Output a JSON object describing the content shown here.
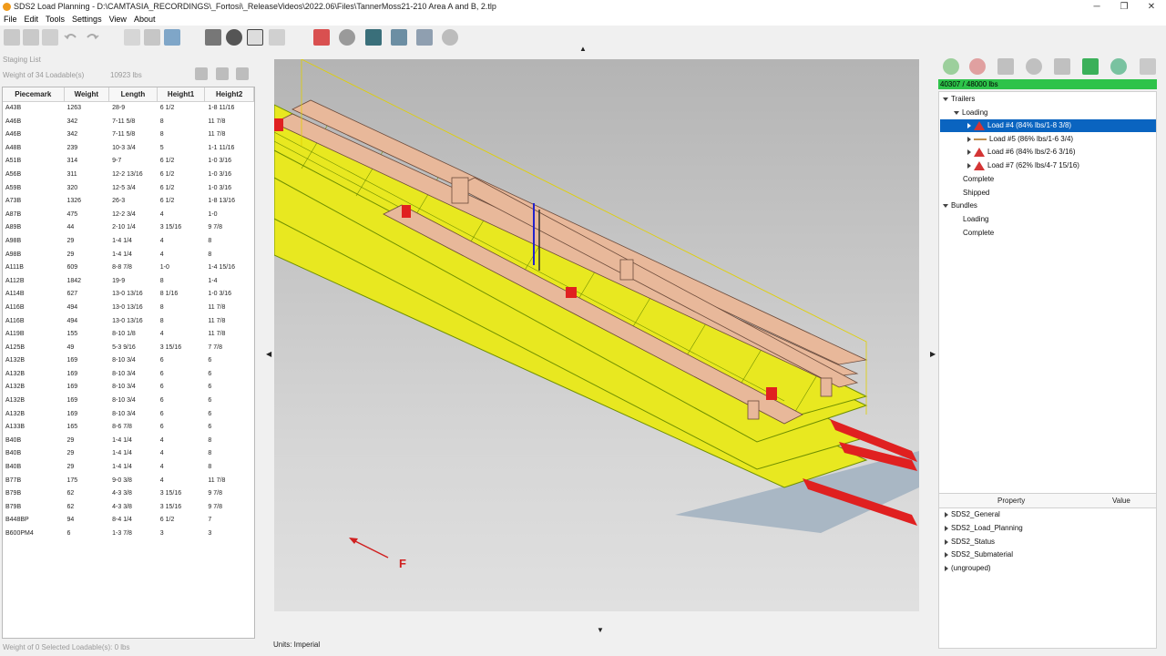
{
  "window": {
    "title": "SDS2 Load Planning - D:\\CAMTASIA_RECORDINGS\\_Fortosi\\_ReleaseVideos\\2022.06\\Files\\TannerMoss21-210 Area A and B, 2.tlp",
    "minimize": "─",
    "maximize": "❐",
    "close": "✕"
  },
  "menu": [
    "File",
    "Edit",
    "Tools",
    "Settings",
    "View",
    "About"
  ],
  "staging": {
    "title": "Staging List",
    "weight_label": "Weight of 34 Loadable(s)",
    "weight_value": "10923 lbs",
    "columns": [
      "Piecemark",
      "Weight",
      "Length",
      "Height1",
      "Height2"
    ],
    "rows": [
      [
        "A43B",
        "1263",
        "28-9",
        "6 1/2",
        "1-8 11/16"
      ],
      [
        "A46B",
        "342",
        "7-11 5/8",
        "8",
        "11 7/8"
      ],
      [
        "A46B",
        "342",
        "7-11 5/8",
        "8",
        "11 7/8"
      ],
      [
        "A48B",
        "239",
        "10-3 3/4",
        "5",
        "1-1 11/16"
      ],
      [
        "A51B",
        "314",
        "9-7",
        "6 1/2",
        "1-0 3/16"
      ],
      [
        "A56B",
        "311",
        "12-2 13/16",
        "6 1/2",
        "1-0 3/16"
      ],
      [
        "A59B",
        "320",
        "12-5 3/4",
        "6 1/2",
        "1-0 3/16"
      ],
      [
        "A73B",
        "1326",
        "26-3",
        "6 1/2",
        "1-8 13/16"
      ],
      [
        "A87B",
        "475",
        "12-2 3/4",
        "4",
        "1-0"
      ],
      [
        "A89B",
        "44",
        "2-10 1/4",
        "3 15/16",
        "9 7/8"
      ],
      [
        "A98B",
        "29",
        "1-4 1/4",
        "4",
        "8"
      ],
      [
        "A98B",
        "29",
        "1-4 1/4",
        "4",
        "8"
      ],
      [
        "A111B",
        "609",
        "8-8 7/8",
        "1-0",
        "1-4 15/16"
      ],
      [
        "A112B",
        "1842",
        "19-9",
        "8",
        "1-4"
      ],
      [
        "A114B",
        "627",
        "13-0 13/16",
        "8 1/16",
        "1-0 3/16"
      ],
      [
        "A116B",
        "494",
        "13-0 13/16",
        "8",
        "11 7/8"
      ],
      [
        "A116B",
        "494",
        "13-0 13/16",
        "8",
        "11 7/8"
      ],
      [
        "A119B",
        "155",
        "8-10 1/8",
        "4",
        "11 7/8"
      ],
      [
        "A125B",
        "49",
        "5-3 9/16",
        "3 15/16",
        "7 7/8"
      ],
      [
        "A132B",
        "169",
        "8-10 3/4",
        "6",
        "6"
      ],
      [
        "A132B",
        "169",
        "8-10 3/4",
        "6",
        "6"
      ],
      [
        "A132B",
        "169",
        "8-10 3/4",
        "6",
        "6"
      ],
      [
        "A132B",
        "169",
        "8-10 3/4",
        "6",
        "6"
      ],
      [
        "A132B",
        "169",
        "8-10 3/4",
        "6",
        "6"
      ],
      [
        "A133B",
        "165",
        "8-6 7/8",
        "6",
        "6"
      ],
      [
        "B40B",
        "29",
        "1-4 1/4",
        "4",
        "8"
      ],
      [
        "B40B",
        "29",
        "1-4 1/4",
        "4",
        "8"
      ],
      [
        "B40B",
        "29",
        "1-4 1/4",
        "4",
        "8"
      ],
      [
        "B77B",
        "175",
        "9-0 3/8",
        "4",
        "11 7/8"
      ],
      [
        "B79B",
        "62",
        "4-3 3/8",
        "3 15/16",
        "9 7/8"
      ],
      [
        "B79B",
        "62",
        "4-3 3/8",
        "3 15/16",
        "9 7/8"
      ],
      [
        "B448BP",
        "94",
        "8-4 1/4",
        "6 1/2",
        "7"
      ],
      [
        "B600PM4",
        "6",
        "1-3 7/8",
        "3",
        "3"
      ]
    ],
    "selected_status": "Weight of 0 Selected Loadable(s): 0 lbs"
  },
  "viewport": {
    "units": "Units: Imperial",
    "axis_label": "F",
    "colors": {
      "deck": "#e8e820",
      "grid_line": "#6f8f00",
      "member": "#e8b89a",
      "fork": "#e02020",
      "base": "#a9b7c4"
    }
  },
  "right": {
    "capacity": "40307 / 48000 lbs",
    "tree": {
      "trailers": "Trailers",
      "loading": "Loading",
      "loads": [
        "Load #4 (84% lbs/1-8 3/8)",
        "Load #5 (86% lbs/1-6 3/4)",
        "Load #6 (84% lbs/2-6 3/16)",
        "Load #7 (62% lbs/4-7 15/16)"
      ],
      "complete": "Complete",
      "shipped": "Shipped",
      "bundles": "Bundles",
      "bundles_loading": "Loading",
      "bundles_complete": "Complete"
    },
    "properties": {
      "col_property": "Property",
      "col_value": "Value",
      "groups": [
        "SDS2_General",
        "SDS2_Load_Planning",
        "SDS2_Status",
        "SDS2_Submaterial",
        "(ungrouped)"
      ]
    }
  }
}
